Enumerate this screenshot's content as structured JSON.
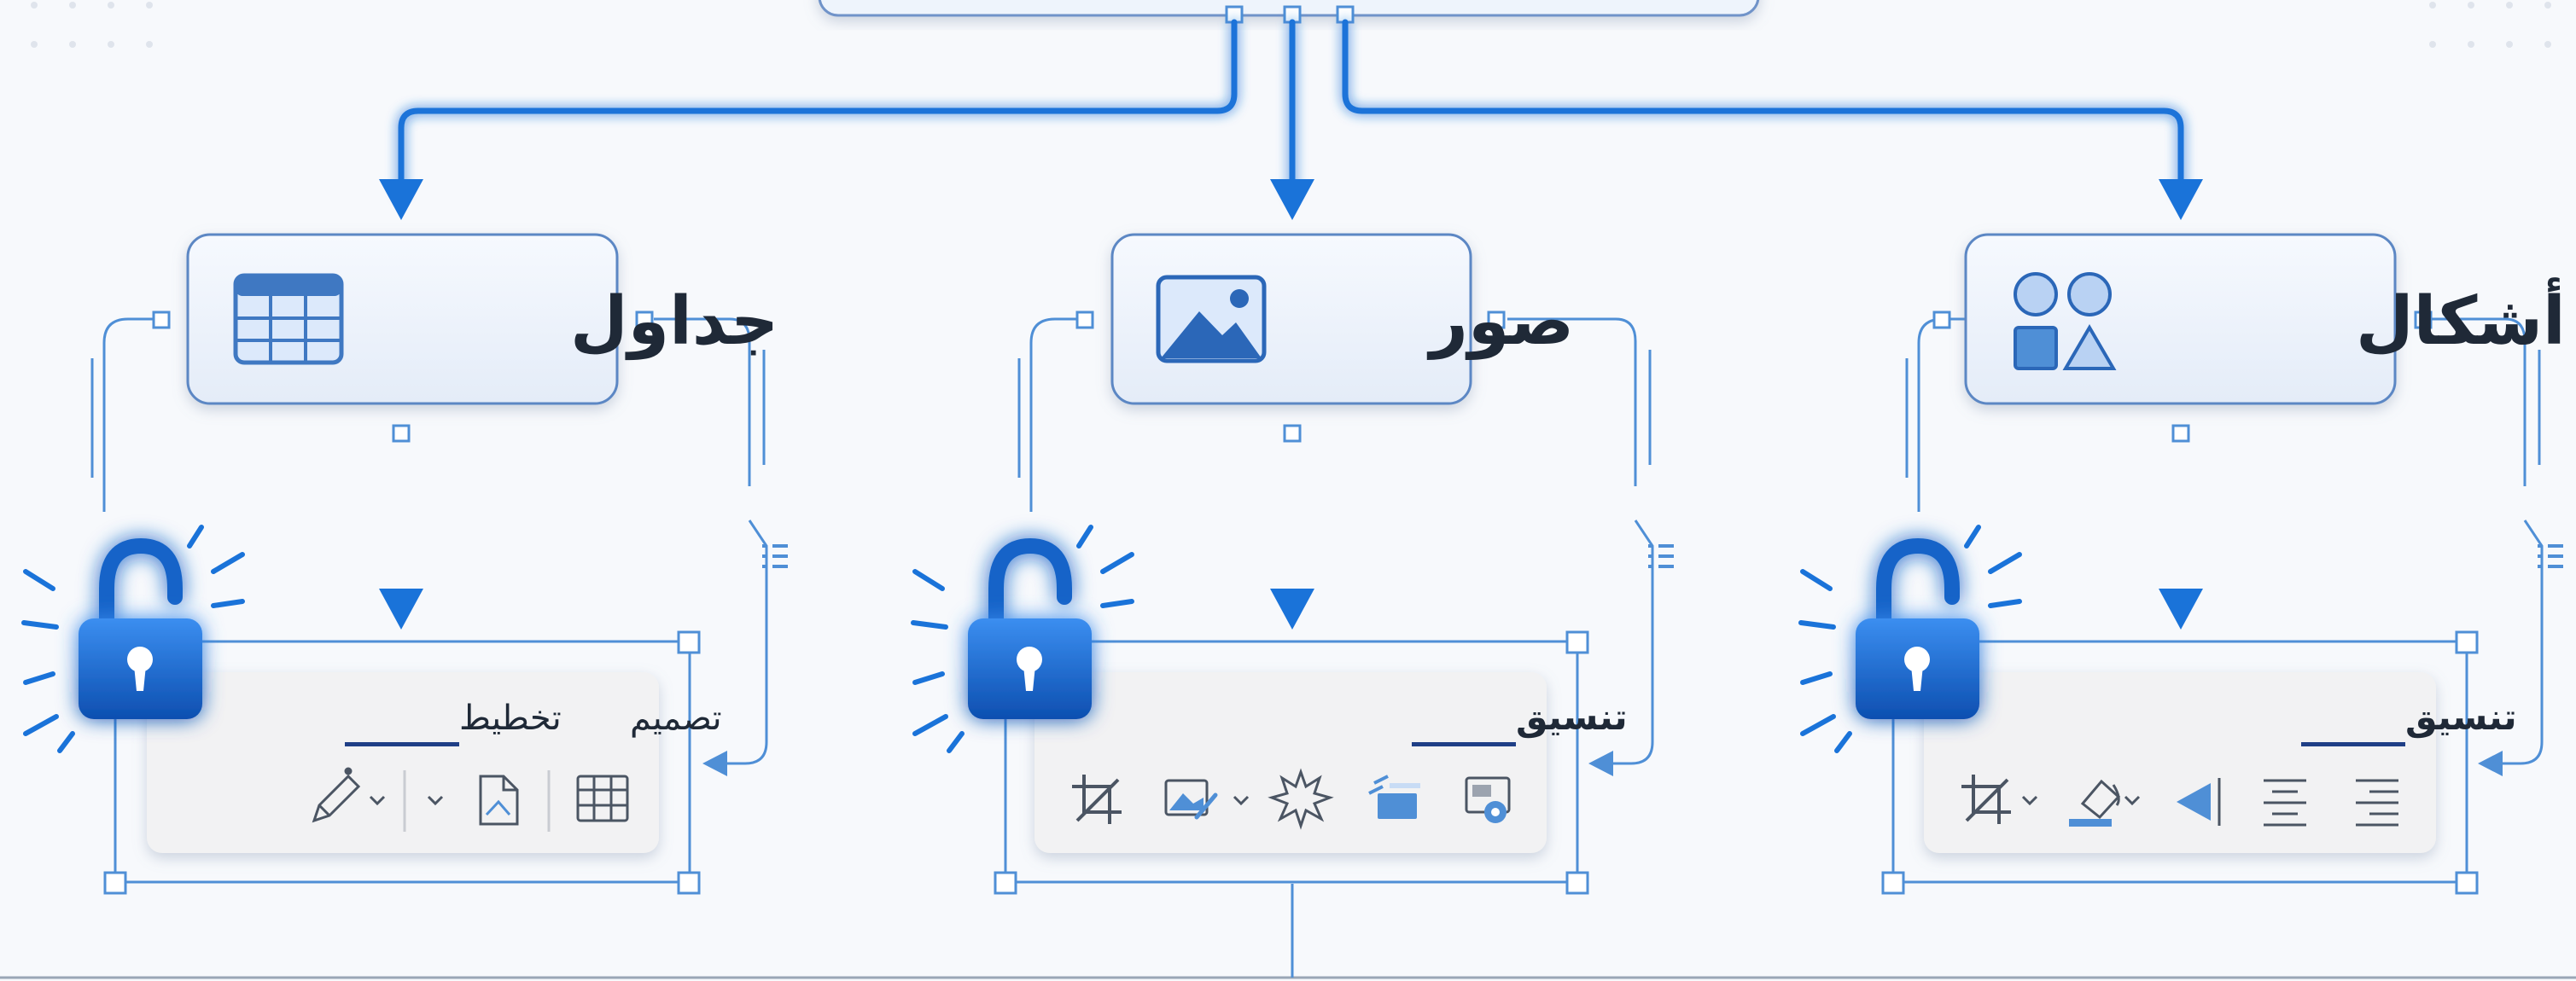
{
  "categories": [
    {
      "title": "جداول",
      "header_icon": "table-icon",
      "tabs": [
        {
          "label": "تصميم",
          "active": false
        },
        {
          "label": "تخطيط",
          "active": true
        }
      ],
      "tool_icons": [
        "table-grid-icon",
        "page-layout-icon",
        "dropdown-chevron-icon",
        "pen-style-icon",
        "chevron-down-icon"
      ],
      "lock_icon": "unlocked-padlock-icon"
    },
    {
      "title": "صور",
      "header_icon": "image-icon",
      "tabs": [
        {
          "label": "تنسيق",
          "active": true
        }
      ],
      "tool_icons": [
        "picture-settings-icon",
        "picture-position-icon",
        "artistic-effects-icon",
        "picture-style-icon",
        "crop-icon"
      ],
      "lock_icon": "unlocked-padlock-icon"
    },
    {
      "title": "أشكال",
      "header_icon": "shapes-icon",
      "tabs": [
        {
          "label": "تنسيق",
          "active": true
        }
      ],
      "tool_icons": [
        "align-right-icon",
        "align-center-icon",
        "flip-icon",
        "shape-fill-icon",
        "crop-icon"
      ],
      "lock_icon": "unlocked-padlock-icon"
    }
  ],
  "colors": {
    "accent": "#1a73d9",
    "connector": "#4f8fd6",
    "node_border": "#5b87c4",
    "node_fill": "#eef4fc",
    "toolbar_fill": "#f2f2f3",
    "lock": "#1664c8",
    "tab_underline": "#1f3f86"
  }
}
